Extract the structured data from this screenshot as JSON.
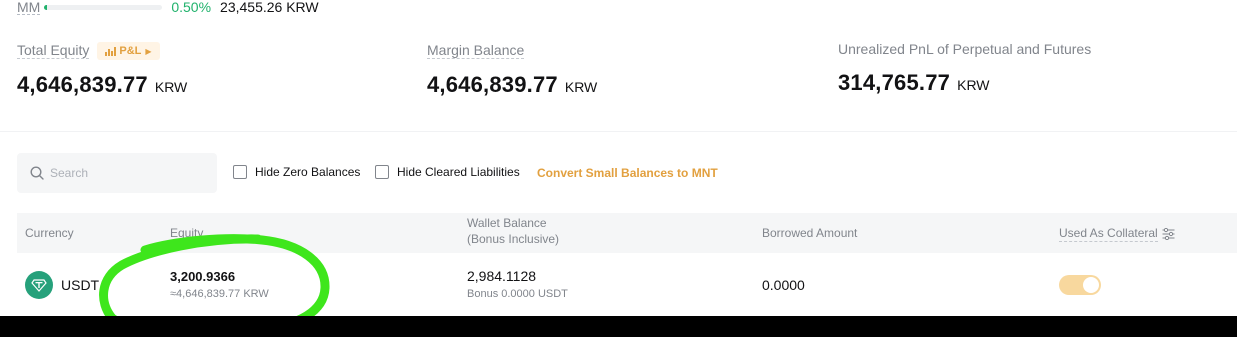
{
  "mm": {
    "label": "MM",
    "progress": 0.005,
    "percent": "0.50%",
    "amount": "23,455.26 KRW"
  },
  "summary": {
    "total_equity": {
      "label": "Total Equity",
      "badge": "P&L",
      "value": "4,646,839.77",
      "unit": "KRW"
    },
    "margin_balance": {
      "label": "Margin Balance",
      "value": "4,646,839.77",
      "unit": "KRW"
    },
    "unrealized_pnl": {
      "label": "Unrealized PnL of Perpetual and Futures",
      "value": "314,765.77",
      "unit": "KRW"
    }
  },
  "filters": {
    "search_placeholder": "Search",
    "hide_zero": "Hide Zero Balances",
    "hide_cleared": "Hide Cleared Liabilities",
    "convert": "Convert Small Balances to MNT"
  },
  "table": {
    "headers": {
      "currency": "Currency",
      "equity": "Equity",
      "wallet_balance": "Wallet Balance",
      "wallet_balance_sub": "(Bonus Inclusive)",
      "borrowed": "Borrowed Amount",
      "collateral": "Used As Collateral"
    },
    "rows": [
      {
        "currency": "USDT",
        "equity": "3,200.9366",
        "equity_krw": "≈4,646,839.77 KRW",
        "wallet_balance": "2,984.1128",
        "bonus": "Bonus 0.0000 USDT",
        "borrowed": "0.0000",
        "collateral": true
      }
    ]
  },
  "colors": {
    "accent": "#e2a03f",
    "positive": "#20b26c",
    "annotation": "#3ee61c",
    "usdt": "#26a17b"
  }
}
